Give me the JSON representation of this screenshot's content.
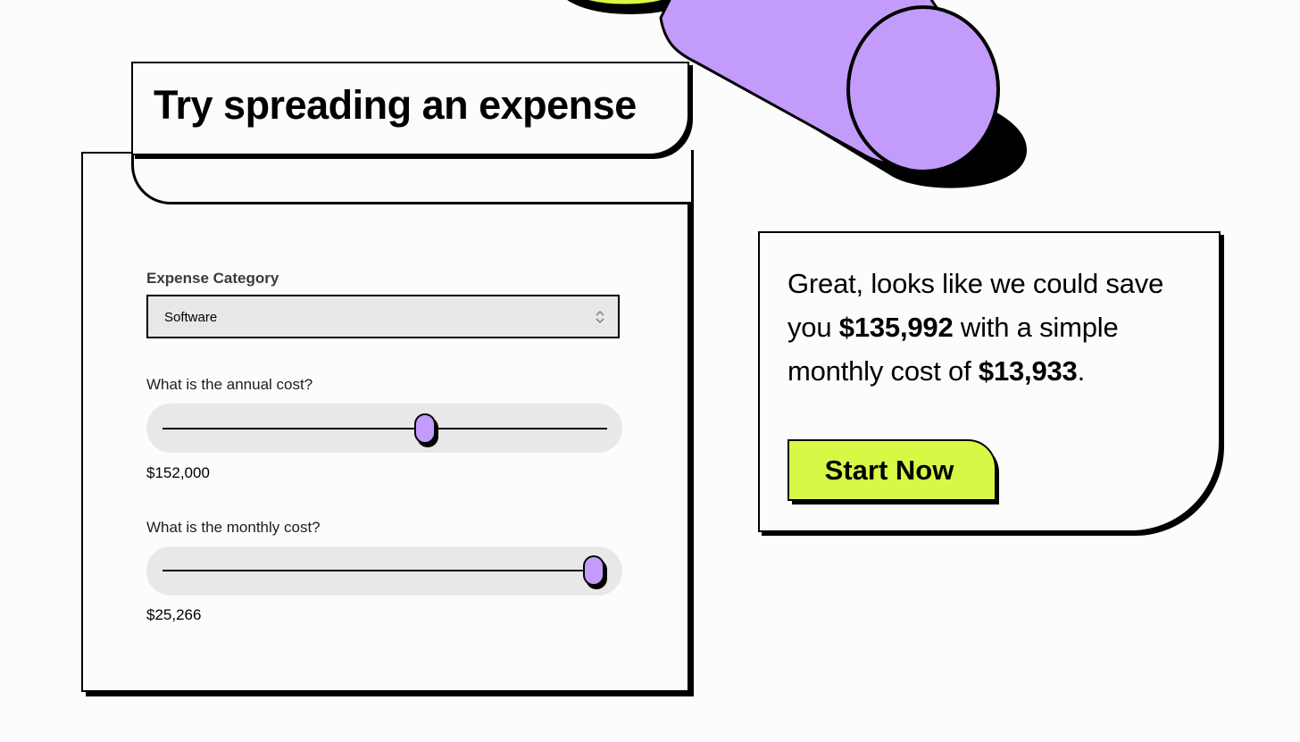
{
  "title": "Try spreading an expense",
  "form": {
    "category_label": "Expense Category",
    "category_value": "Software",
    "annual_label": "What is the annual cost?",
    "annual_value": "$152,000",
    "annual_slider_fraction": 0.59,
    "monthly_label": "What is the monthly cost?",
    "monthly_value": "$25,266",
    "monthly_slider_fraction": 0.97
  },
  "result": {
    "line1": "Great, looks like we could save you ",
    "savings": "$135,992",
    "line2": " with a simple monthly cost of ",
    "monthly": "$13,933",
    "end": "."
  },
  "cta": {
    "label": "Start Now"
  },
  "colors": {
    "accent_purple": "#c39bfb",
    "accent_lime": "#d7f945",
    "ink": "#000000",
    "panel": "#fcfcfc",
    "field_bg": "#e8e8e8"
  },
  "icons": {
    "select_arrows": "chevron-updown-icon"
  }
}
